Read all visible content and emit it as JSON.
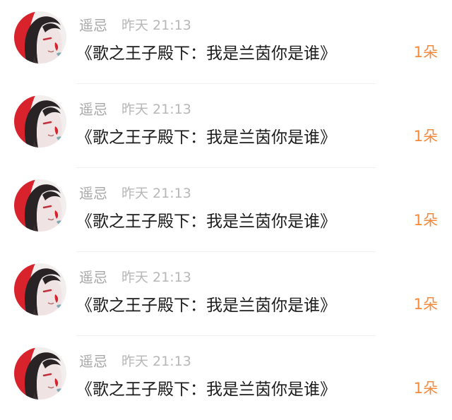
{
  "colors": {
    "name": "#a7a7a7",
    "time": "#b7b7b7",
    "message": "#1b1b1b",
    "count": "#f5893a",
    "avatar_red": "#d8232d",
    "divider": "#f0f0f0"
  },
  "items": [
    {
      "name": "遥忌",
      "time": "昨天 21:13",
      "message": "《歌之王子殿下：我是兰茵你是谁》",
      "count": "1朵",
      "avatar_icon": "anime-girl-avatar"
    },
    {
      "name": "遥忌",
      "time": "昨天 21:13",
      "message": "《歌之王子殿下：我是兰茵你是谁》",
      "count": "1朵",
      "avatar_icon": "anime-girl-avatar"
    },
    {
      "name": "遥忌",
      "time": "昨天 21:13",
      "message": "《歌之王子殿下：我是兰茵你是谁》",
      "count": "1朵",
      "avatar_icon": "anime-girl-avatar"
    },
    {
      "name": "遥忌",
      "time": "昨天 21:13",
      "message": "《歌之王子殿下：我是兰茵你是谁》",
      "count": "1朵",
      "avatar_icon": "anime-girl-avatar"
    },
    {
      "name": "遥忌",
      "time": "昨天 21:13",
      "message": "《歌之王子殿下：我是兰茵你是谁》",
      "count": "1朵",
      "avatar_icon": "anime-girl-avatar"
    }
  ]
}
